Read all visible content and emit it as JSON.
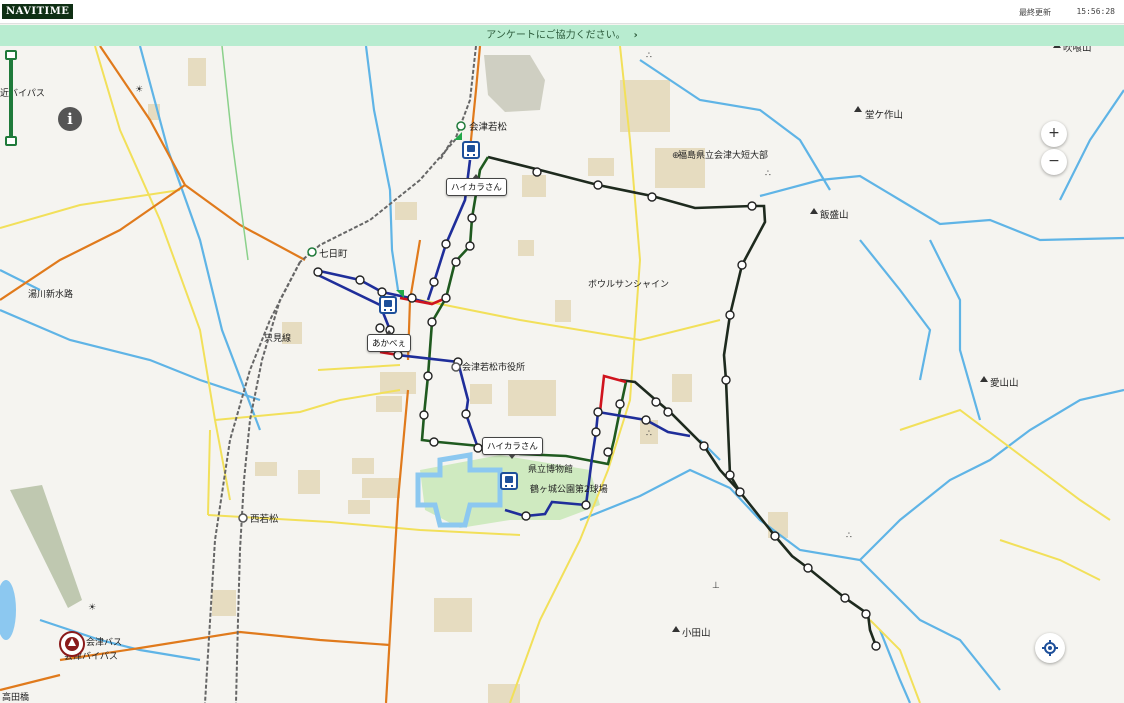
{
  "header": {
    "logo": "NAVITIME",
    "updated_label": "最終更新",
    "updated_time": "15:56:28"
  },
  "survey": {
    "text": "アンケートにご協力ください。",
    "chevron": "›"
  },
  "map": {
    "labels": {
      "aizuwakamatsu": "会津若松",
      "nanokamachi": "七日町",
      "nishiwakamatsu": "西若松",
      "shiyakusho": "会津若松市役所",
      "kenritsu_hakubutsukan": "県立博物館",
      "tsurugajo": "鶴ヶ城公園第2球場",
      "bowl": "ボウルサンシャイン",
      "fukushima_kenritsu": "福島県立会津大短大部",
      "dogasakuyama": "堂ケ作山",
      "iimoriyama": "飯盛山",
      "odayama": "小田山",
      "kengyoyama": "愛山山",
      "yugawa_shinsuiro": "湯川新水路",
      "tadami_line": "只見線",
      "bypass_top": "近バイパス",
      "bypass_bottom": "会津バイパス",
      "aizu_bus": "会津バス",
      "takadahashi": "高田橋",
      "top_right": "吹喰山"
    },
    "bubbles": {
      "haikara_top": "ハイカラさん",
      "akabe": "あかべぇ",
      "haikara_mid": "ハイカラさん"
    },
    "controls": {
      "zoom_in": "+",
      "zoom_out": "−",
      "info": "i"
    },
    "icons": [
      "info-icon",
      "zoom-in-icon",
      "zoom-out-icon",
      "locate-icon",
      "bus-stop-icon",
      "bus-vehicle-icon",
      "station-icon",
      "mountain-icon",
      "shrine-icon",
      "temple-icon"
    ],
    "colors": {
      "route_black": "#1e2a1e",
      "route_blue": "#1f2e9a",
      "route_green": "#1f5a1f",
      "route_red": "#d0141e",
      "road_orange": "#e07a1c",
      "road_yellow": "#f2e05a",
      "river": "#5fb4e6",
      "building": "#e6dcc0",
      "park": "#cfeac0",
      "moat": "#8cc8f0",
      "header_green": "#0f2f14",
      "survey_bg": "#b8ecd0"
    }
  }
}
